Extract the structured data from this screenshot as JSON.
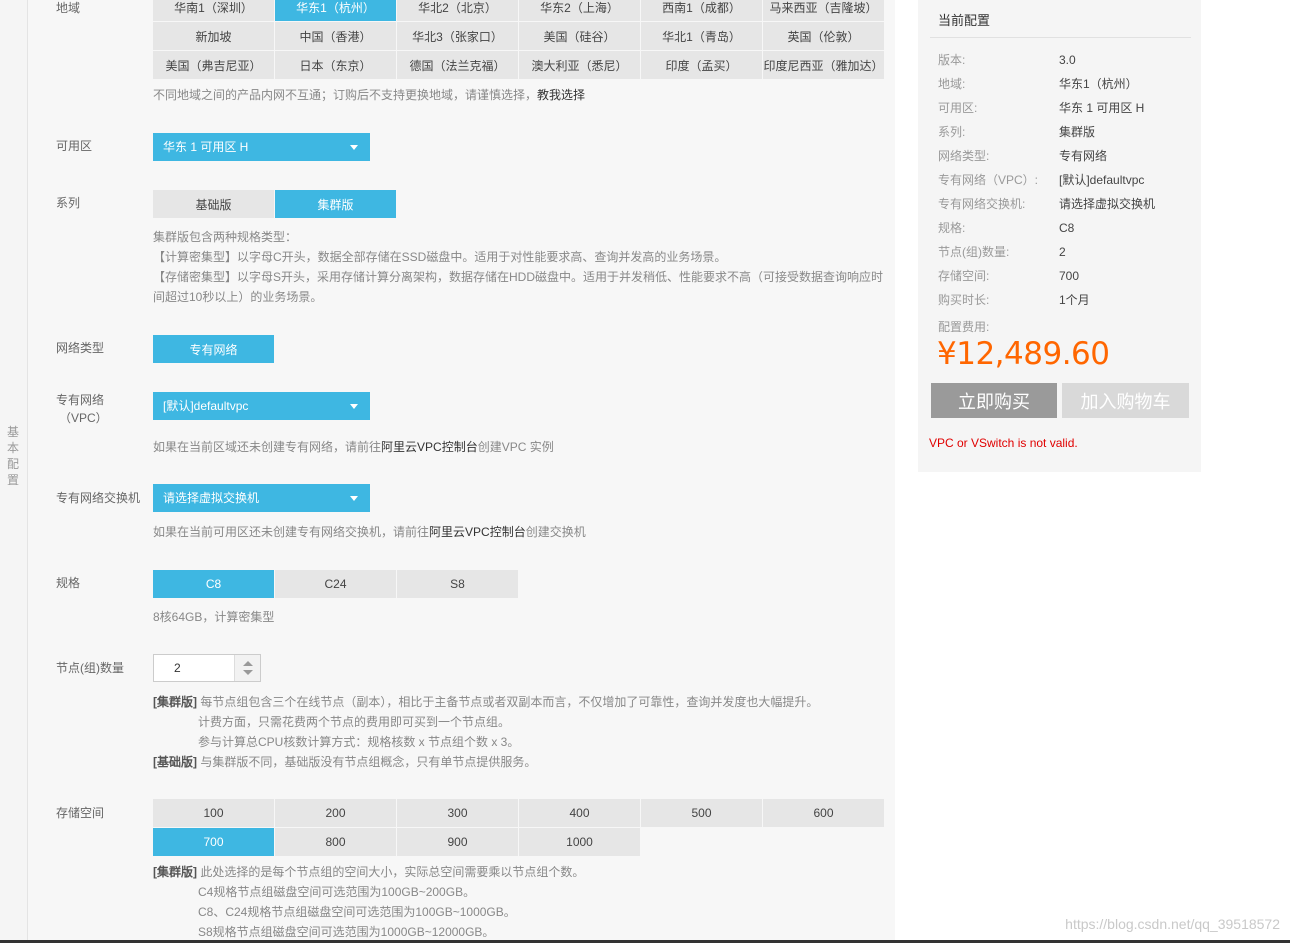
{
  "section_label": "基本配置",
  "region": {
    "label": "地域",
    "selected": "华东1（杭州）",
    "options": [
      "华南1（深圳）",
      "华东1（杭州）",
      "华北2（北京）",
      "华东2（上海）",
      "西南1（成都）",
      "马来西亚（吉隆坡）",
      "新加坡",
      "中国（香港）",
      "华北3（张家口）",
      "美国（硅谷）",
      "华北1（青岛）",
      "英国（伦敦）",
      "美国（弗吉尼亚）",
      "日本（东京）",
      "德国（法兰克福）",
      "澳大利亚（悉尼）",
      "印度（孟买）",
      "印度尼西亚（雅加达）"
    ],
    "note": "不同地域之间的产品内网不互通；订购后不支持更换地域，请谨慎选择，",
    "note_link": "教我选择"
  },
  "zone": {
    "label": "可用区",
    "value": "华东 1 可用区 H"
  },
  "series": {
    "label": "系列",
    "options": [
      "基础版",
      "集群版"
    ],
    "selected": "集群版",
    "notes": [
      "集群版包含两种规格类型：",
      "【计算密集型】以字母C开头，数据全部存储在SSD磁盘中。适用于对性能要求高、查询并发高的业务场景。",
      "【存储密集型】以字母S开头，采用存储计算分离架构，数据存储在HDD磁盘中。适用于并发稍低、性能要求不高（可接受数据查询响应时间超过10秒以上）的业务场景。"
    ]
  },
  "network_type": {
    "label": "网络类型",
    "value": "专有网络"
  },
  "vpc": {
    "label_line1": "专有网络",
    "label_line2": "（VPC）",
    "value": "[默认]defaultvpc",
    "note_pre": "如果在当前区域还未创建专有网络，请前往",
    "note_link": "阿里云VPC控制台",
    "note_post": "创建VPC 实例"
  },
  "vswitch": {
    "label": "专有网络交换机",
    "value": "请选择虚拟交换机",
    "note_pre": "如果在当前可用区还未创建专有网络交换机，请前往",
    "note_link": "阿里云VPC控制台",
    "note_post": "创建交换机"
  },
  "spec": {
    "label": "规格",
    "options": [
      "C8",
      "C24",
      "S8"
    ],
    "selected": "C8",
    "note": "8核64GB，计算密集型"
  },
  "nodes": {
    "label": "节点(组)数量",
    "value": "2",
    "notes": {
      "tag1": "[集群版]",
      "line1": " 每节点组包含三个在线节点（副本），相比于主备节点或者双副本而言，不仅增加了可靠性，查询并发度也大幅提升。",
      "line2": "计费方面，只需花费两个节点的费用即可买到一个节点组。",
      "line3": "参与计算总CPU核数计算方式：规格核数 x 节点组个数 x 3。",
      "tag2": "[基础版]",
      "line4": " 与集群版不同，基础版没有节点组概念，只有单节点提供服务。"
    }
  },
  "storage": {
    "label": "存储空间",
    "options": [
      "100",
      "200",
      "300",
      "400",
      "500",
      "600",
      "700",
      "800",
      "900",
      "1000"
    ],
    "selected": "700",
    "notes": {
      "tag": "[集群版]",
      "line1": " 此处选择的是每个节点组的空间大小，实际总空间需要乘以节点组个数。",
      "line2": "C4规格节点组磁盘空间可选范围为100GB~200GB。",
      "line3": "C8、C24规格节点组磁盘空间可选范围为100GB~1000GB。",
      "line4": "S8规格节点组磁盘空间可选范围为1000GB~12000GB。"
    }
  },
  "summary": {
    "title": "当前配置",
    "rows": [
      {
        "k": "版本:",
        "v": "3.0"
      },
      {
        "k": "地域:",
        "v": "华东1（杭州）"
      },
      {
        "k": "可用区:",
        "v": "华东 1 可用区 H"
      },
      {
        "k": "系列:",
        "v": "集群版"
      },
      {
        "k": "网络类型:",
        "v": "专有网络"
      },
      {
        "k": "专有网络（VPC）:",
        "v": "[默认]defaultvpc"
      },
      {
        "k": "专有网络交换机:",
        "v": "请选择虚拟交换机"
      },
      {
        "k": "规格:",
        "v": "C8"
      },
      {
        "k": "节点(组)数量:",
        "v": "2"
      },
      {
        "k": "存储空间:",
        "v": "700"
      },
      {
        "k": "购买时长:",
        "v": "1个月"
      }
    ],
    "cost_label": "配置费用:",
    "price": "¥12,489.60",
    "buy_label": "立即购买",
    "cart_label": "加入购物车",
    "error": "VPC or VSwitch is not valid."
  },
  "watermark": "https://blog.csdn.net/qq_39518572",
  "colors": {
    "accent": "#3eb7e2",
    "price": "#ff6600",
    "error": "#e00000"
  }
}
